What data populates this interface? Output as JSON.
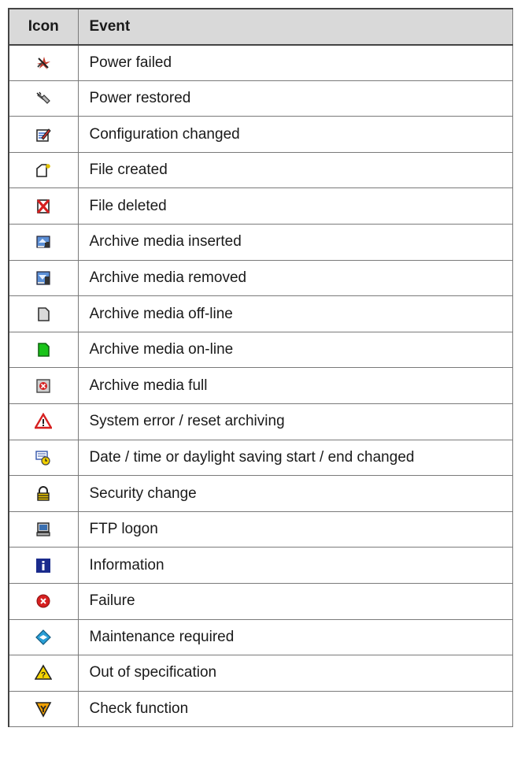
{
  "table": {
    "header": {
      "icon": "Icon",
      "event": "Event"
    },
    "rows": [
      {
        "icon": "power-failed-icon",
        "event": "Power failed"
      },
      {
        "icon": "power-restored-icon",
        "event": "Power restored"
      },
      {
        "icon": "configuration-changed-icon",
        "event": "Configuration changed"
      },
      {
        "icon": "file-created-icon",
        "event": "File created"
      },
      {
        "icon": "file-deleted-icon",
        "event": "File deleted"
      },
      {
        "icon": "archive-media-inserted-icon",
        "event": "Archive media inserted"
      },
      {
        "icon": "archive-media-removed-icon",
        "event": "Archive media removed"
      },
      {
        "icon": "archive-media-offline-icon",
        "event": "Archive media off-line"
      },
      {
        "icon": "archive-media-online-icon",
        "event": "Archive media on-line"
      },
      {
        "icon": "archive-media-full-icon",
        "event": "Archive media full"
      },
      {
        "icon": "system-error-icon",
        "event": "System error / reset archiving"
      },
      {
        "icon": "date-time-changed-icon",
        "event": "Date / time or daylight saving start / end changed"
      },
      {
        "icon": "security-change-icon",
        "event": "Security change"
      },
      {
        "icon": "ftp-logon-icon",
        "event": "FTP logon"
      },
      {
        "icon": "information-icon",
        "event": "Information"
      },
      {
        "icon": "failure-icon",
        "event": "Failure"
      },
      {
        "icon": "maintenance-required-icon",
        "event": "Maintenance required"
      },
      {
        "icon": "out-of-specification-icon",
        "event": "Out of specification"
      },
      {
        "icon": "check-function-icon",
        "event": "Check function"
      }
    ]
  }
}
